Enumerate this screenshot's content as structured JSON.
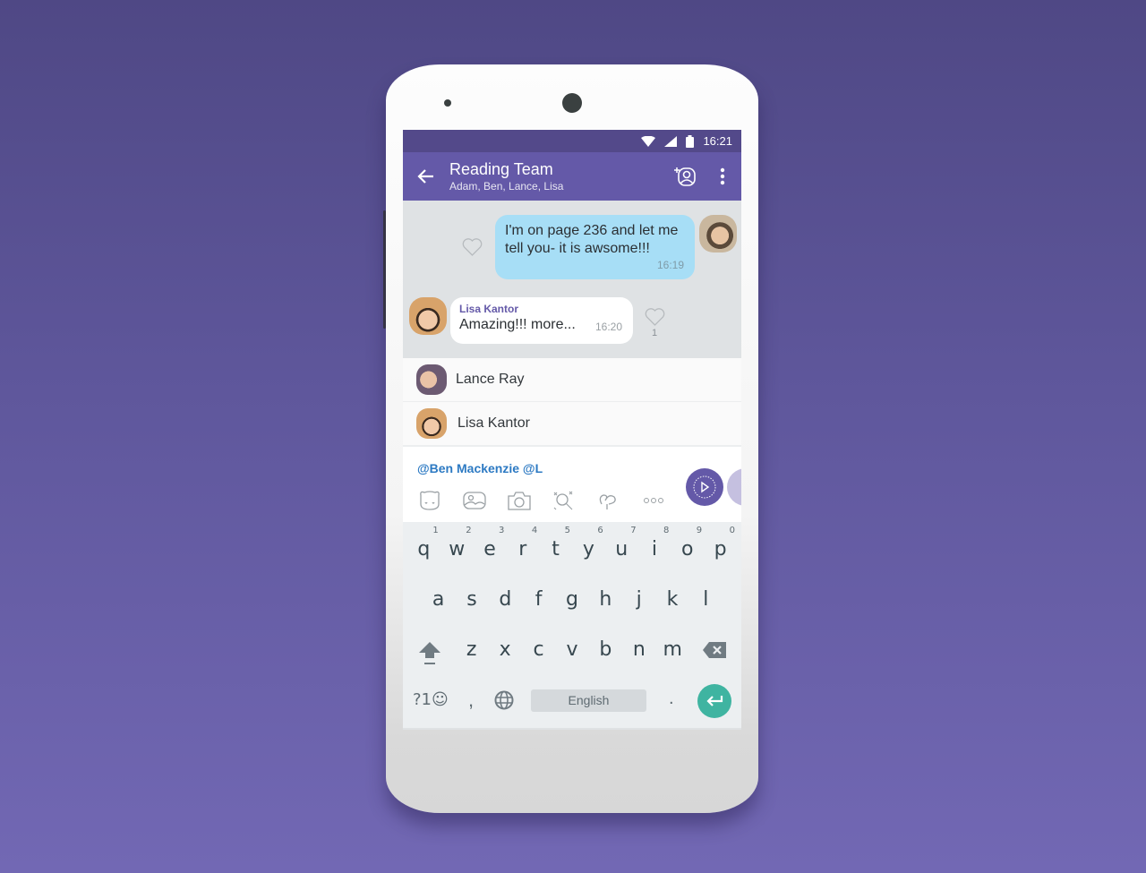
{
  "status_bar": {
    "time": "16:21",
    "icons": [
      "wifi-icon",
      "signal-icon",
      "battery-icon"
    ]
  },
  "app_bar": {
    "title": "Reading Team",
    "subtitle": "Adam, Ben, Lance, Lisa",
    "icons": [
      "back-arrow-icon",
      "add-participant-icon",
      "more-options-icon"
    ]
  },
  "messages": [
    {
      "direction": "outgoing",
      "text_line1": "I'm on page 236 and let me",
      "text_line2": "tell you- it is awsome!!!",
      "time": "16:19",
      "likes": ""
    },
    {
      "direction": "incoming",
      "sender": "Lisa Kantor",
      "text": "Amazing!!! more...",
      "time": "16:20",
      "likes": "1"
    }
  ],
  "mention_suggestions": [
    {
      "name": "Lance Ray"
    },
    {
      "name": "Lisa Kantor"
    }
  ],
  "composer": {
    "input_value": "@Ben Mackenzie @L",
    "toolbar_icons": [
      "sticker-icon",
      "gallery-icon",
      "camera-icon",
      "doodle-icon",
      "gif-icon",
      "more-icon"
    ]
  },
  "keyboard": {
    "row1": [
      "q",
      "w",
      "e",
      "r",
      "t",
      "y",
      "u",
      "i",
      "o",
      "p"
    ],
    "row1_hints": [
      "1",
      "2",
      "3",
      "4",
      "5",
      "6",
      "7",
      "8",
      "9",
      "0"
    ],
    "row2": [
      "a",
      "s",
      "d",
      "f",
      "g",
      "h",
      "j",
      "k",
      "l"
    ],
    "row3": [
      "z",
      "x",
      "c",
      "v",
      "b",
      "n",
      "m"
    ],
    "symbols_key": "?1☺",
    "comma": ",",
    "period": ".",
    "space_label": "English"
  },
  "colors": {
    "app_bar": "#6459a8",
    "status_bar": "#53498a",
    "outgoing_bubble": "#a7def6",
    "mention_text": "#2d7ac3",
    "enter_key": "#3fb4a1"
  }
}
